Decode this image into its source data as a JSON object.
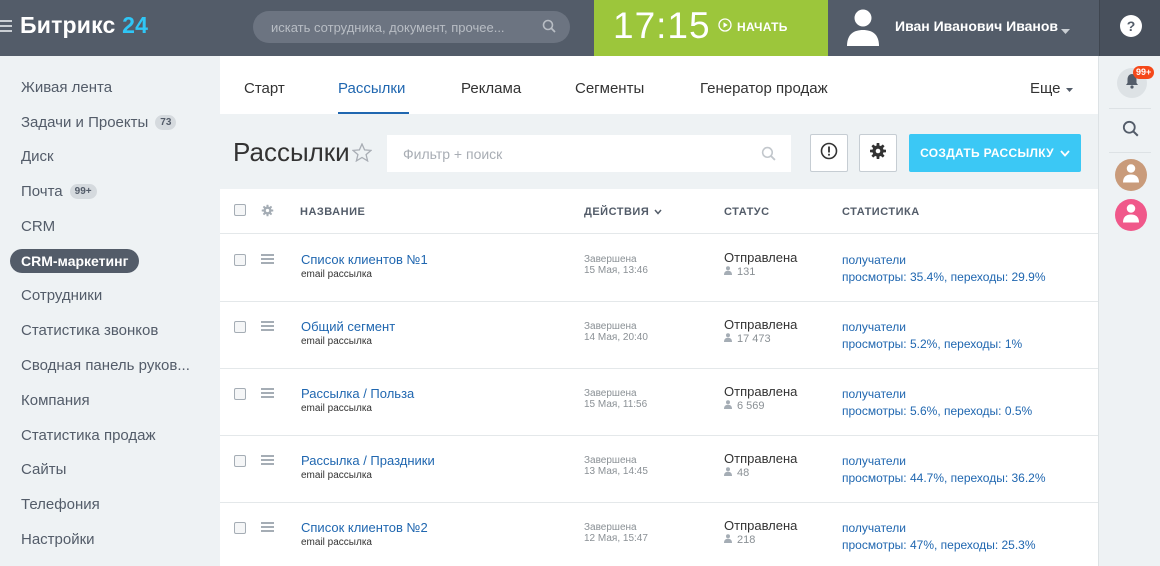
{
  "app": {
    "logo_text": "Битрикс",
    "logo_num": "24"
  },
  "header": {
    "search_placeholder": "искать сотрудника, документ, прочее...",
    "time": "17:15",
    "start_label": "НАЧАТЬ",
    "user_name": "Иван Иванович Иванов",
    "help_label": "?"
  },
  "sidebar": {
    "items": [
      {
        "label": "Живая лента",
        "badge": ""
      },
      {
        "label": "Задачи и Проекты",
        "badge": "73"
      },
      {
        "label": "Диск",
        "badge": ""
      },
      {
        "label": "Почта",
        "badge": "99+"
      },
      {
        "label": "CRM",
        "badge": ""
      },
      {
        "label": "CRM-маркетинг",
        "badge": "",
        "active": true
      },
      {
        "label": "Сотрудники",
        "badge": ""
      },
      {
        "label": "Статистика звонков",
        "badge": ""
      },
      {
        "label": "Сводная панель руков...",
        "badge": ""
      },
      {
        "label": "Компания",
        "badge": ""
      },
      {
        "label": "Статистика продаж",
        "badge": ""
      },
      {
        "label": "Сайты",
        "badge": ""
      },
      {
        "label": "Телефония",
        "badge": ""
      },
      {
        "label": "Настройки",
        "badge": ""
      }
    ]
  },
  "tabs": {
    "items": [
      "Старт",
      "Рассылки",
      "Реклама",
      "Сегменты",
      "Генератор продаж"
    ],
    "active": "Рассылки",
    "more_label": "Еще"
  },
  "toolbar": {
    "page_title": "Рассылки",
    "filter_placeholder": "Фильтр + поиск",
    "create_label": "СОЗДАТЬ РАССЫЛКУ"
  },
  "grid": {
    "columns": [
      "НАЗВАНИЕ",
      "ДЕЙСТВИЯ",
      "СТАТУС",
      "СТАТИСТИКА"
    ],
    "rows": [
      {
        "title": "Список клиентов №1",
        "subtitle": "email рассылка",
        "action": "Завершена",
        "date": "15 Мая, 13:46",
        "status": "Отправлена",
        "recipients": "131",
        "stats_link": "получатели",
        "stats": "просмотры: 35.4%, переходы: 29.9%"
      },
      {
        "title": "Общий сегмент",
        "subtitle": "email рассылка",
        "action": "Завершена",
        "date": "14 Мая, 20:40",
        "status": "Отправлена",
        "recipients": "17 473",
        "stats_link": "получатели",
        "stats": "просмотры: 5.2%, переходы: 1%"
      },
      {
        "title": "Рассылка / Польза",
        "subtitle": "email рассылка",
        "action": "Завершена",
        "date": "15 Мая, 11:56",
        "status": "Отправлена",
        "recipients": "6 569",
        "stats_link": "получатели",
        "stats": "просмотры: 5.6%, переходы: 0.5%"
      },
      {
        "title": "Рассылка / Праздники",
        "subtitle": "email рассылка",
        "action": "Завершена",
        "date": "13 Мая, 14:45",
        "status": "Отправлена",
        "recipients": "48",
        "stats_link": "получатели",
        "stats": "просмотры: 44.7%, переходы: 36.2%"
      },
      {
        "title": "Список клиентов №2",
        "subtitle": "email рассылка",
        "action": "Завершена",
        "date": "12 Мая, 15:47",
        "status": "Отправлена",
        "recipients": "218",
        "stats_link": "получатели",
        "stats": "просмотры: 47%, переходы: 25.3%"
      }
    ]
  },
  "rightrail": {
    "notifications_badge": "99+"
  },
  "colors": {
    "topbar": "#535c69",
    "accent_blue": "#2067b0",
    "logo_accent": "#2fc6f6",
    "timer_green": "#9cc63b",
    "create_button": "#3bc8f5"
  }
}
